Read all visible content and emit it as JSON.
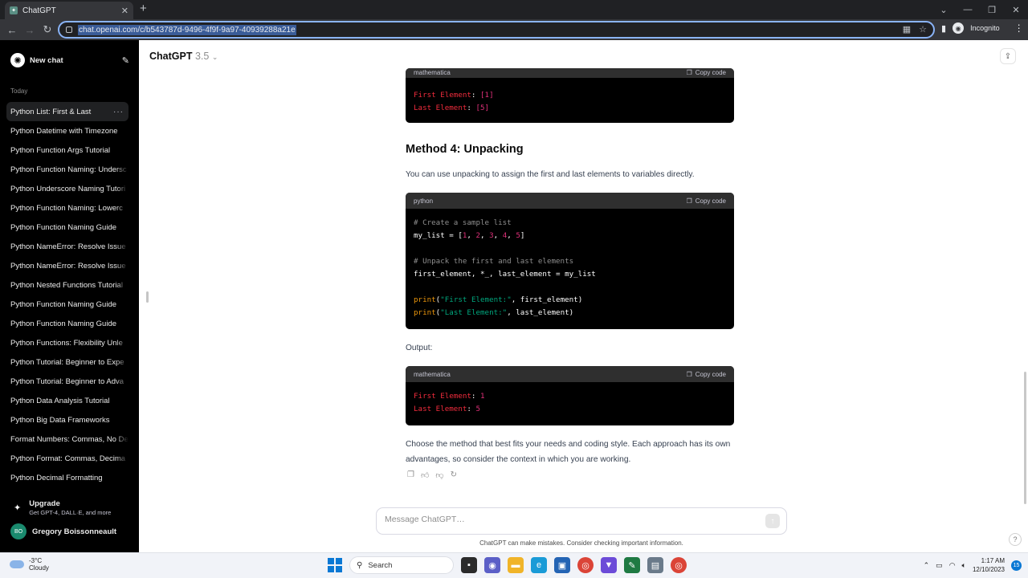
{
  "browser": {
    "tab_title": "ChatGPT",
    "url": "chat.openai.com/c/b543787d-9496-4f9f-9a97-40939288a21e",
    "incognito_label": "Incognito"
  },
  "sidebar": {
    "new_chat_label": "New chat",
    "section_label": "Today",
    "items": [
      "Python List: First & Last",
      "Python Datetime with Timezone",
      "Python Function Args Tutorial",
      "Python Function Naming: Undersc",
      "Python Underscore Naming Tutori",
      "Python Function Naming: Lowerc",
      "Python Function Naming Guide",
      "Python NameError: Resolve Issue",
      "Python NameError: Resolve Issue",
      "Python Nested Functions Tutorial",
      "Python Function Naming Guide",
      "Python Function Naming Guide",
      "Python Functions: Flexibility Unle",
      "Python Tutorial: Beginner to Expe",
      "Python Tutorial: Beginner to Adva",
      "Python Data Analysis Tutorial",
      "Python Big Data Frameworks",
      "Format Numbers: Commas, No De",
      "Python Format: Commas, Decima",
      "Python Decimal Formatting"
    ],
    "upgrade_title": "Upgrade",
    "upgrade_sub": "Get GPT-4, DALL·E, and more",
    "user_initials": "BO",
    "user_name": "Gregory Boissonneault"
  },
  "header": {
    "model_name": "ChatGPT",
    "model_version": "3.5"
  },
  "content": {
    "block1": {
      "lang": "mathematica",
      "copy_label": "Copy code",
      "line1_key": "First Element",
      "line1_val": "[1]",
      "line2_key": "Last Element",
      "line2_val": "[5]"
    },
    "method4_heading": "Method 4: Unpacking",
    "method4_desc": "You can use unpacking to assign the first and last elements to variables directly.",
    "block2": {
      "lang": "python",
      "copy_label": "Copy code"
    },
    "output_label": "Output:",
    "block3": {
      "lang": "mathematica",
      "copy_label": "Copy code",
      "line1_key": "First Element",
      "line1_val": "1",
      "line2_key": "Last Element",
      "line2_val": "5"
    },
    "closing_text": "Choose the method that best fits your needs and coding style. Each approach has its own advantages, so consider the context in which you are working."
  },
  "composer": {
    "placeholder": "Message ChatGPT…",
    "disclaimer": "ChatGPT can make mistakes. Consider checking important information."
  },
  "taskbar": {
    "temperature": "-3°C",
    "condition": "Cloudy",
    "search_label": "Search",
    "time": "1:17 AM",
    "date": "12/10/2023",
    "notif_count": "15"
  }
}
